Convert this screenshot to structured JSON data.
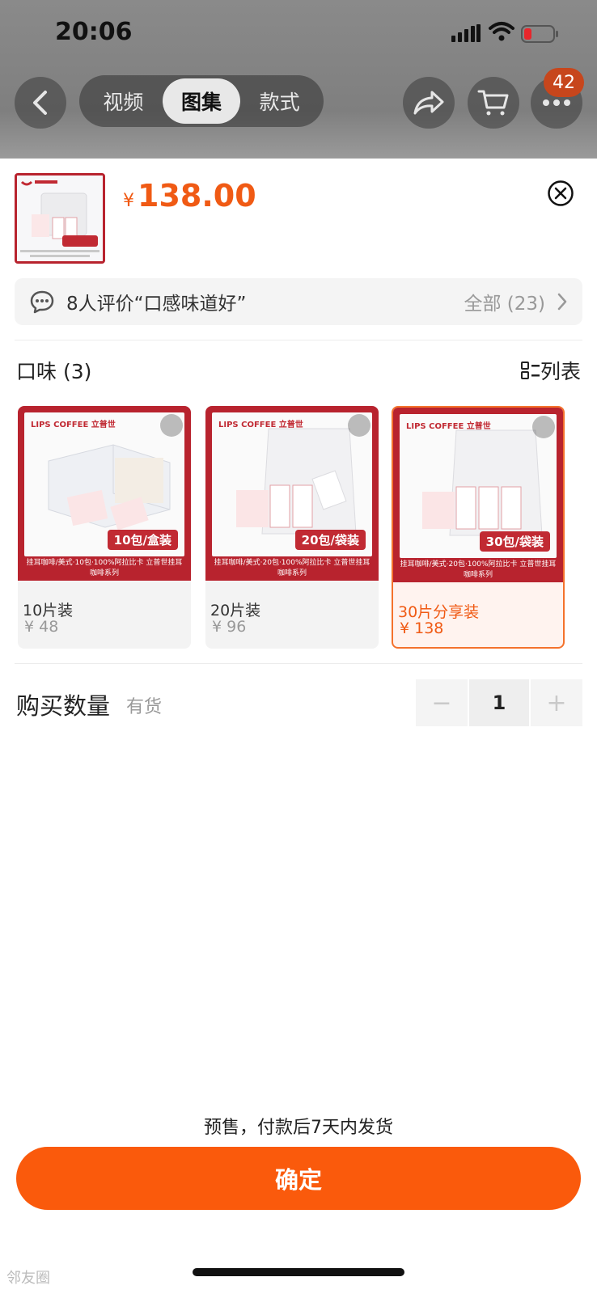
{
  "status": {
    "time": "20:06"
  },
  "nav": {
    "tabs": [
      {
        "label": "视频"
      },
      {
        "label": "图集"
      },
      {
        "label": "款式"
      }
    ],
    "cart_badge": "42"
  },
  "product": {
    "currency": "¥",
    "price": "138.00",
    "thumb_tag": "30包/袋装"
  },
  "review": {
    "summary": "8人评价“口感味道好”",
    "all_label": "全部 (23)"
  },
  "flavor": {
    "title": "口味 (3)",
    "list_view_label": "列表",
    "options": [
      {
        "name": "10片装",
        "price": "¥ 48",
        "tag": "10包/盒装",
        "brand": "LIPS COFFEE 立普世",
        "caption": "挂耳咖啡/美式·10包·100%阿拉比卡 立普世挂耳咖啡系列"
      },
      {
        "name": "20片装",
        "price": "¥ 96",
        "tag": "20包/袋装",
        "brand": "LIPS COFFEE 立普世",
        "caption": "挂耳咖啡/美式·20包·100%阿拉比卡 立普世挂耳咖啡系列"
      },
      {
        "name": "30片分享装",
        "price": "¥ 138",
        "tag": "30包/袋装",
        "brand": "LIPS COFFEE 立普世",
        "caption": "挂耳咖啡/美式·20包·100%阿拉比卡 立普世挂耳咖啡系列"
      }
    ]
  },
  "quantity": {
    "label": "购买数量",
    "stock": "有货",
    "value": "1",
    "minus": "−",
    "plus": "+"
  },
  "footer": {
    "presale": "预售，付款后7天内发货",
    "confirm_label": "确定",
    "watermark": "邻友圈"
  },
  "colors": {
    "accent": "#fa5a0c",
    "price": "#f05a14",
    "brand_red": "#b8232e"
  }
}
